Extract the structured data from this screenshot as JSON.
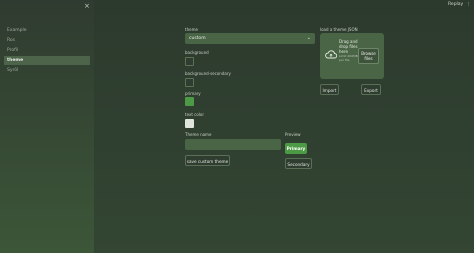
{
  "sidebar": {
    "close": "×",
    "items": [
      {
        "label": "Example",
        "active": false
      },
      {
        "label": "Ros",
        "active": false
      },
      {
        "label": "Profil",
        "active": false
      },
      {
        "label": "theme",
        "active": true
      },
      {
        "label": "Syröl",
        "active": false
      }
    ]
  },
  "header": {
    "replay": "Replay",
    "menu": "⋮"
  },
  "theme": {
    "label": "theme",
    "selected": "custom",
    "background_label": "background",
    "background_secondary_label": "background-secondary",
    "primary_label": "primary",
    "text_color_label": "text color",
    "colors": {
      "background": "#2f3d30",
      "background_secondary": "#2f3d30",
      "primary": "#4d9a46",
      "text_color": "#dfe5dc"
    },
    "theme_name_label": "Theme name",
    "theme_name_value": "",
    "save_button": "save custom theme"
  },
  "preview": {
    "label": "Preview",
    "primary_button": "Primary",
    "secondary_button": "Secondary"
  },
  "load": {
    "label": "load a theme JSON",
    "drop_text": "Drag and drop files here",
    "limit_text": "Limit 200MB per file",
    "browse_button": "Browse files",
    "import_button": "Import",
    "export_button": "Export"
  }
}
